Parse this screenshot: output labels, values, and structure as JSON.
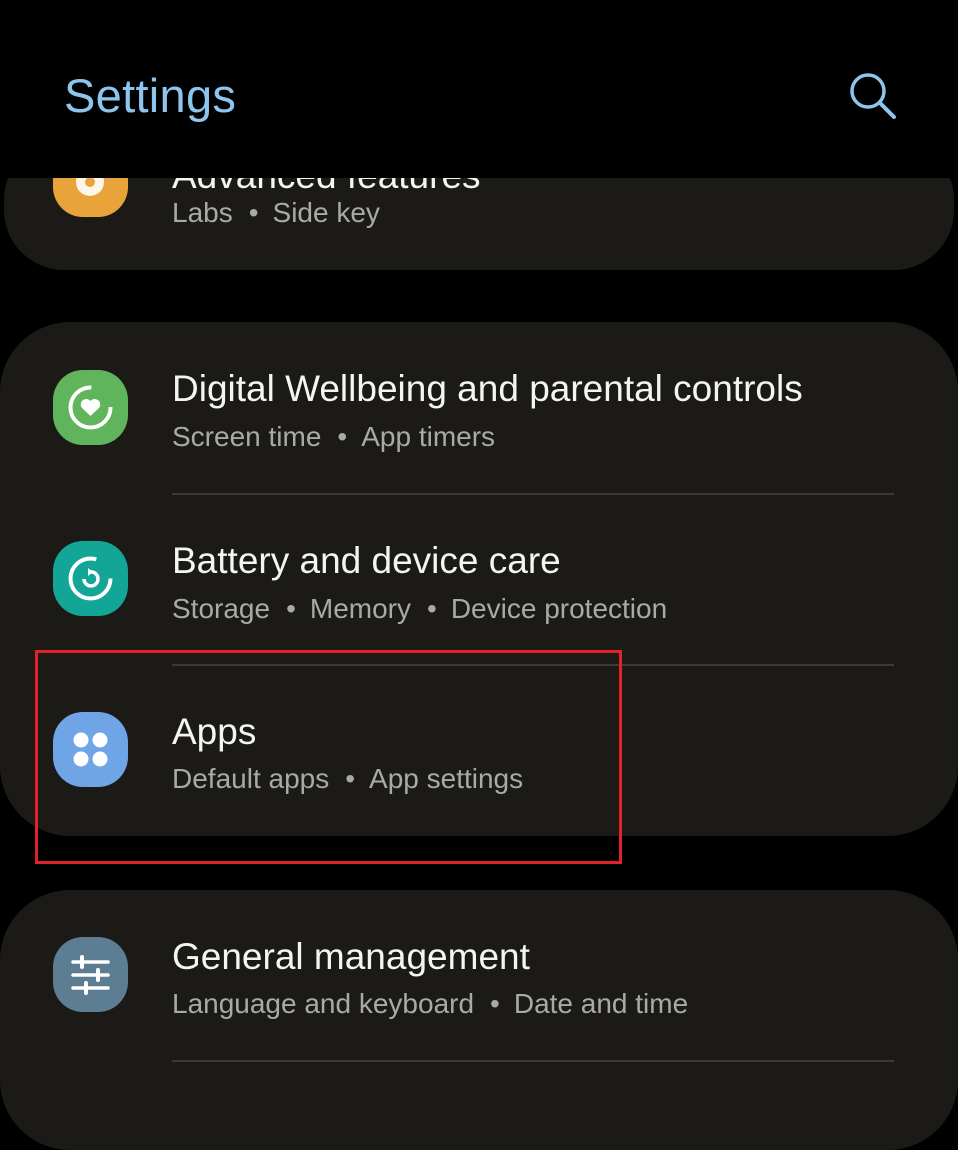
{
  "header": {
    "title": "Settings",
    "search_icon": "search-icon"
  },
  "colors": {
    "title": "#8ec5ee",
    "card": "#1b1a17",
    "highlight": "#e0232b",
    "advanced_icon": "#e8a43b",
    "wellbeing_icon": "#5fb45c",
    "battery_icon": "#13a595",
    "apps_icon": "#6fa5e6",
    "general_icon": "#5d7d93"
  },
  "items": [
    {
      "title": "Advanced features",
      "subtitle": [
        "Labs",
        "Side key"
      ],
      "icon": "puzzle-gear-icon"
    },
    {
      "title": "Digital Wellbeing and parental controls",
      "subtitle": [
        "Screen time",
        "App timers"
      ],
      "icon": "heart-circle-icon"
    },
    {
      "title": "Battery and device care",
      "subtitle": [
        "Storage",
        "Memory",
        "Device protection"
      ],
      "icon": "refresh-circle-icon"
    },
    {
      "title": "Apps",
      "subtitle": [
        "Default apps",
        "App settings"
      ],
      "icon": "four-dots-icon"
    },
    {
      "title": "General management",
      "subtitle": [
        "Language and keyboard",
        "Date and time"
      ],
      "icon": "sliders-icon"
    }
  ],
  "separator": "•"
}
